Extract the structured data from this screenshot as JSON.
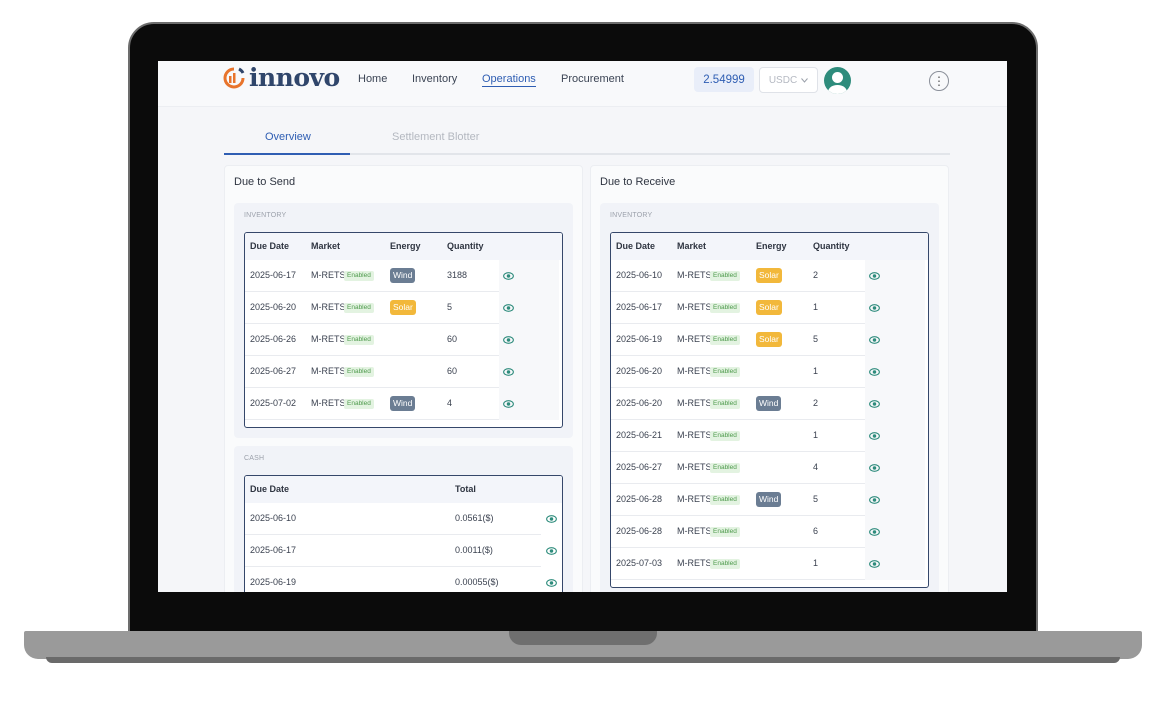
{
  "app": {
    "logo_text": "innovo",
    "nav": [
      "Home",
      "Inventory",
      "Operations",
      "Procurement"
    ],
    "balance": "2.54999",
    "currency": "USDC",
    "more_label": "⋮"
  },
  "tabs": [
    "Overview",
    "Settlement Blotter"
  ],
  "send": {
    "title": "Due to Send",
    "inventory": {
      "label": "INVENTORY",
      "headers": [
        "Due Date",
        "Market",
        "Energy",
        "Quantity"
      ],
      "rows": [
        {
          "date": "2025-06-17",
          "market": "M-RETS",
          "status": "Enabled",
          "energy": "Wind",
          "qty": "3188"
        },
        {
          "date": "2025-06-20",
          "market": "M-RETS",
          "status": "Enabled",
          "energy": "Solar",
          "qty": "5"
        },
        {
          "date": "2025-06-26",
          "market": "M-RETS",
          "status": "Enabled",
          "energy": "",
          "qty": "60"
        },
        {
          "date": "2025-06-27",
          "market": "M-RETS",
          "status": "Enabled",
          "energy": "",
          "qty": "60"
        },
        {
          "date": "2025-07-02",
          "market": "M-RETS",
          "status": "Enabled",
          "energy": "Wind",
          "qty": "4"
        }
      ]
    },
    "cash": {
      "label": "CASH",
      "headers": [
        "Due Date",
        "Total"
      ],
      "rows": [
        {
          "date": "2025-06-10",
          "total": "0.0561($)"
        },
        {
          "date": "2025-06-17",
          "total": "0.0011($)"
        },
        {
          "date": "2025-06-19",
          "total": "0.00055($)"
        }
      ]
    }
  },
  "receive": {
    "title": "Due to Receive",
    "inventory": {
      "label": "INVENTORY",
      "headers": [
        "Due Date",
        "Market",
        "Energy",
        "Quantity"
      ],
      "rows": [
        {
          "date": "2025-06-10",
          "market": "M-RETS",
          "status": "Enabled",
          "energy": "Solar",
          "qty": "2"
        },
        {
          "date": "2025-06-17",
          "market": "M-RETS",
          "status": "Enabled",
          "energy": "Solar",
          "qty": "1"
        },
        {
          "date": "2025-06-19",
          "market": "M-RETS",
          "status": "Enabled",
          "energy": "Solar",
          "qty": "5"
        },
        {
          "date": "2025-06-20",
          "market": "M-RETS",
          "status": "Enabled",
          "energy": "",
          "qty": "1"
        },
        {
          "date": "2025-06-20",
          "market": "M-RETS",
          "status": "Enabled",
          "energy": "Wind",
          "qty": "2"
        },
        {
          "date": "2025-06-21",
          "market": "M-RETS",
          "status": "Enabled",
          "energy": "",
          "qty": "1"
        },
        {
          "date": "2025-06-27",
          "market": "M-RETS",
          "status": "Enabled",
          "energy": "",
          "qty": "4"
        },
        {
          "date": "2025-06-28",
          "market": "M-RETS",
          "status": "Enabled",
          "energy": "Wind",
          "qty": "5"
        },
        {
          "date": "2025-06-28",
          "market": "M-RETS",
          "status": "Enabled",
          "energy": "",
          "qty": "6"
        },
        {
          "date": "2025-07-03",
          "market": "M-RETS",
          "status": "Enabled",
          "energy": "",
          "qty": "1"
        }
      ]
    }
  },
  "colors": {
    "primary": "#2f5eb3",
    "teal": "#2e8c7c",
    "logo_orange": "#e8742c",
    "logo_navy": "#30466b",
    "enabled_bg": "#e3f3e1",
    "enabled_text": "#4e9a4c",
    "wind": "#6b7d93",
    "solar": "#f2b83b"
  }
}
